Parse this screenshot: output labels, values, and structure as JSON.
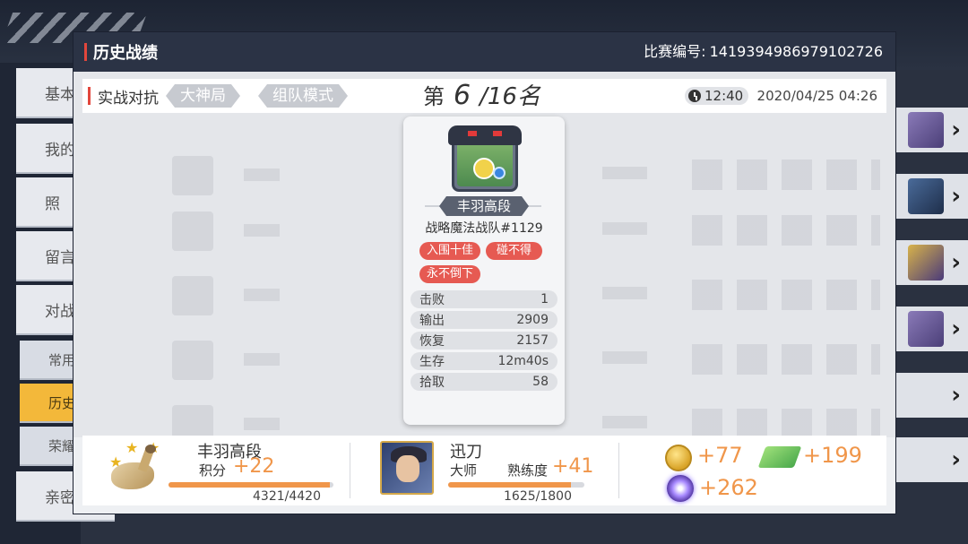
{
  "background": {
    "nav_items": [
      "基本",
      "我的",
      "照",
      "留言",
      "对战"
    ],
    "sub_items": [
      "常用",
      "历史",
      "荣耀",
      "亲密"
    ]
  },
  "modal": {
    "title": "历史战绩",
    "match_id_label": "比赛编号:",
    "match_id": "1419394986979102726"
  },
  "info_bar": {
    "mode": "实战对抗",
    "tags": [
      "大神局",
      "组队模式"
    ],
    "rank_prefix": "第",
    "rank_num": "6",
    "rank_total": "/16名",
    "duration": "12:40",
    "datetime": "2020/04/25 04:26"
  },
  "card": {
    "tier": "丰羽高段",
    "team": "战略魔法战队#1129",
    "badges": [
      "入围十佳",
      "碰不得",
      "永不倒下"
    ],
    "stats": [
      {
        "label": "击败",
        "value": "1"
      },
      {
        "label": "输出",
        "value": "2909"
      },
      {
        "label": "恢复",
        "value": "2157"
      },
      {
        "label": "生存",
        "value": "12m40s"
      },
      {
        "label": "拾取",
        "value": "58"
      }
    ]
  },
  "rank_section": {
    "tier": "丰羽高段",
    "points_label": "积分",
    "points_gain": "+22",
    "progress_text": "4321/4420",
    "progress_fraction": 0.9776
  },
  "hero_section": {
    "name": "迅刀",
    "rank": "大师",
    "mastery_label": "熟练度",
    "mastery_gain": "+41",
    "progress_text": "1625/1800",
    "progress_fraction": 0.9028
  },
  "rewards": {
    "coin": "+77",
    "ticket": "+199",
    "crystal": "+262"
  },
  "colors": {
    "accent_red": "#e2463c",
    "gain_orange": "#f0964a",
    "badge_red": "#e65a52",
    "header_dark": "#2b3345"
  }
}
